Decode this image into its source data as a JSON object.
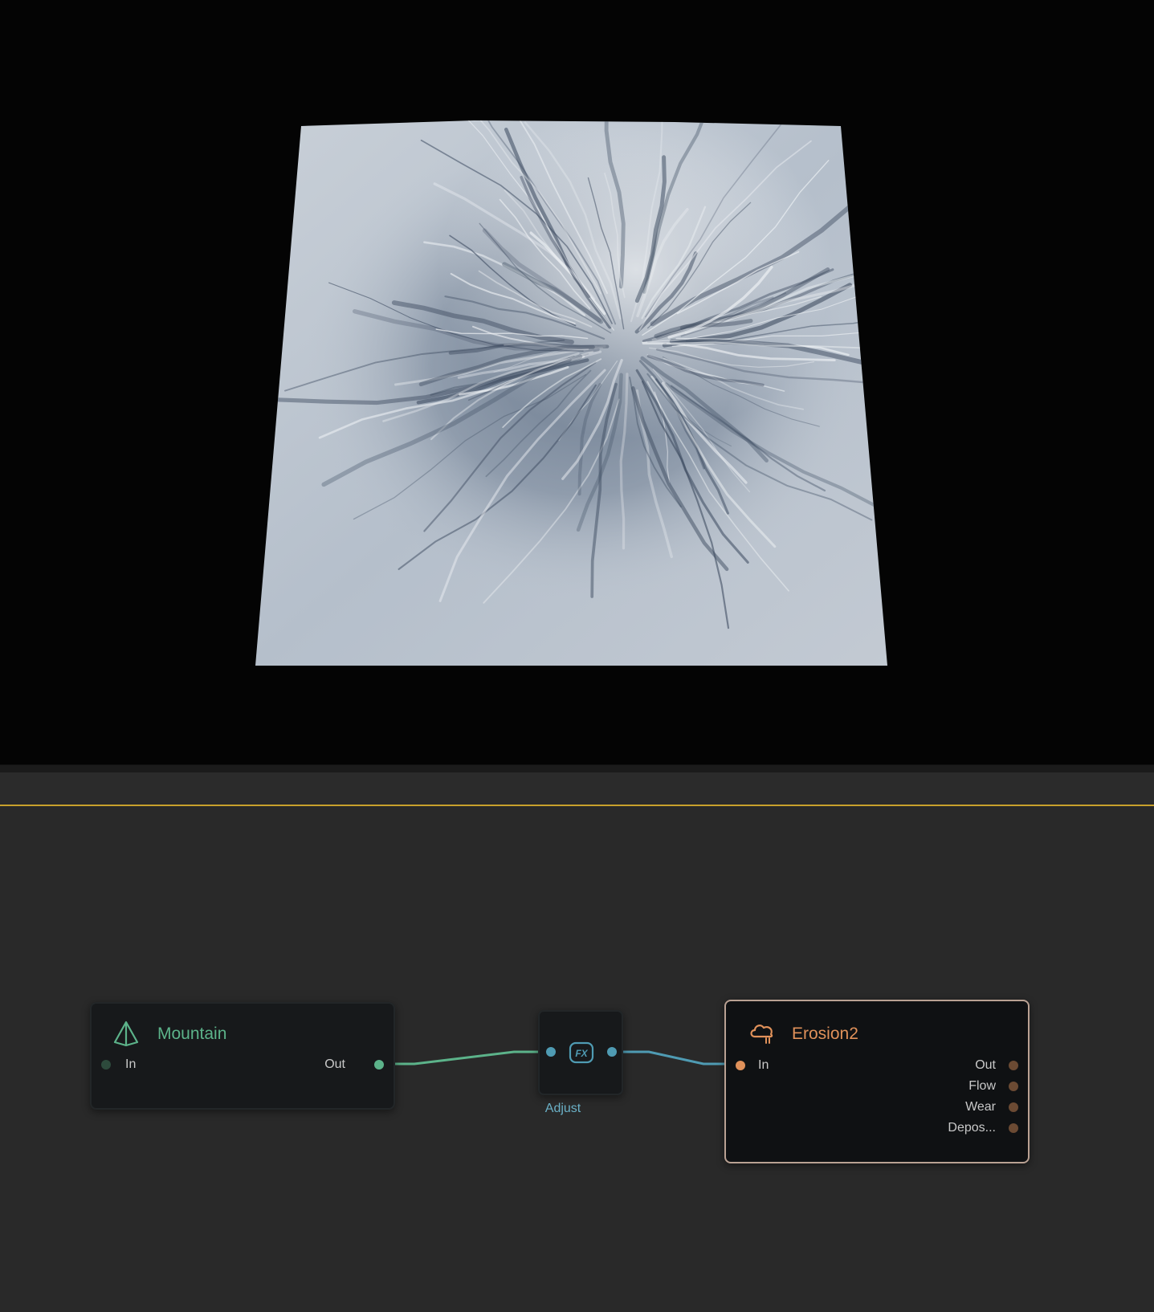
{
  "viewport": {
    "background": "#040404",
    "content": "3D terrain preview of an eroded mountain heightfield"
  },
  "graph": {
    "accent_color": "#c8a12c",
    "nodes": {
      "mountain": {
        "title": "Mountain",
        "icon": "pyramid-icon",
        "color": "#5cb38a",
        "inputs": [
          "In"
        ],
        "outputs": [
          "Out"
        ]
      },
      "adjust": {
        "caption": "Adjust",
        "icon": "fx-icon",
        "color": "#4f9bb3"
      },
      "erosion": {
        "title": "Erosion2",
        "icon": "cloud-rain-icon",
        "color": "#e0915a",
        "inputs": [
          "In"
        ],
        "outputs": [
          "Out",
          "Flow",
          "Wear",
          "Depos..."
        ]
      }
    },
    "wires": [
      {
        "from": "Mountain.Out",
        "to": "Adjust.in",
        "color": "#5cb38a"
      },
      {
        "from": "Adjust.out",
        "to": "Erosion2.In",
        "color": "#4f9bb3"
      }
    ]
  }
}
